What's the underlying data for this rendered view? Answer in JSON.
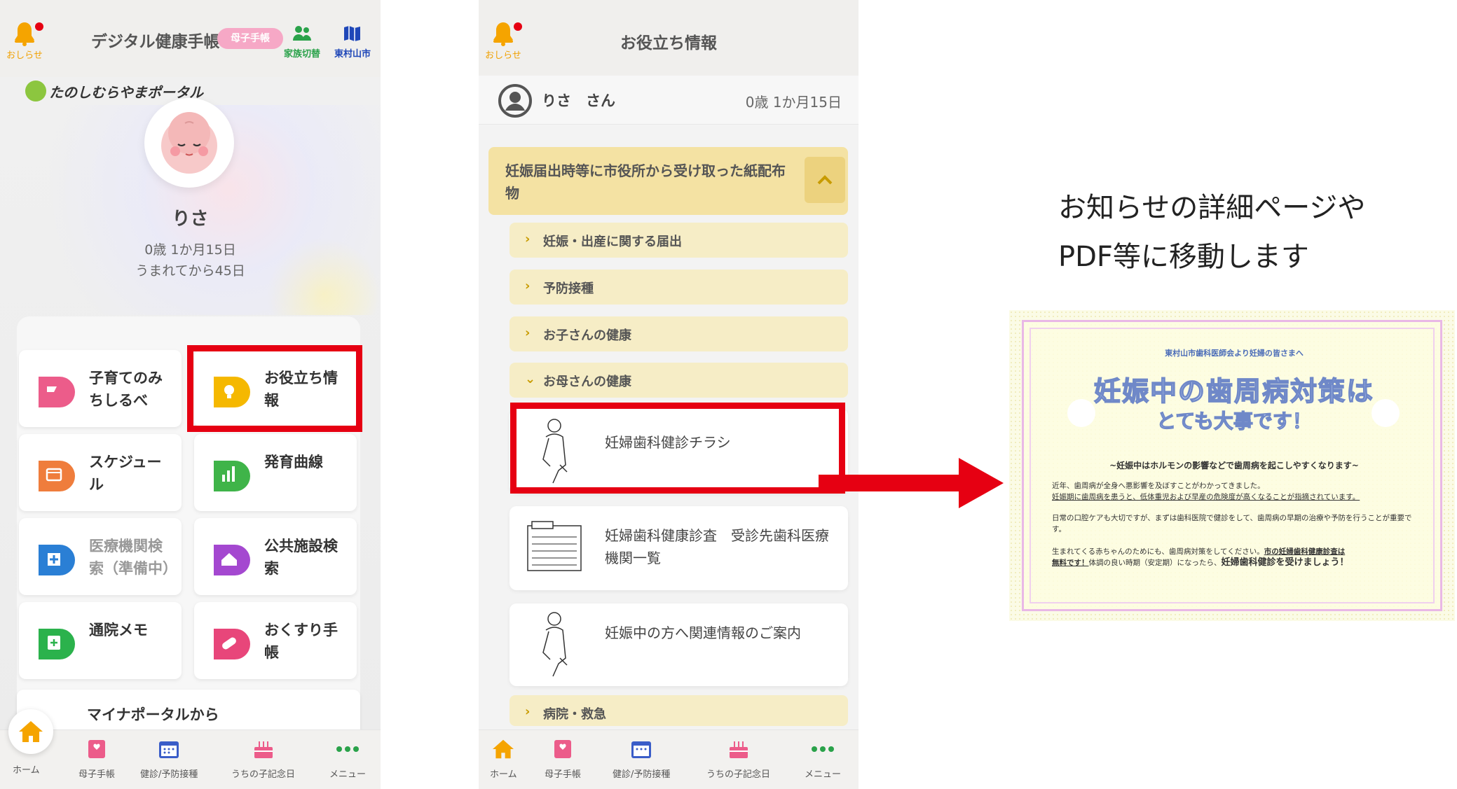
{
  "left_screen": {
    "notify_label": "おしらせ",
    "title": "デジタル健康手帳",
    "badge": "母子手帳",
    "family_switch_label": "家族切替",
    "city_label": "東村山市",
    "brand_logo_text": "たのしむらやまポータル",
    "child_name": "りさ",
    "child_age": "0歳 1か月15日",
    "child_days": "うまれてから45日",
    "menu": [
      {
        "label": "子育てのみちしるべ",
        "color": "#ec5c8a"
      },
      {
        "label": "お役立ち情報",
        "color": "#f5b800"
      },
      {
        "label": "スケジュール",
        "color": "#ef7d3c"
      },
      {
        "label": "発育曲線",
        "color": "#3fb449"
      },
      {
        "label": "医療機関検索（準備中）",
        "color": "#2a7fd5"
      },
      {
        "label": "公共施設検索",
        "color": "#a448d0"
      },
      {
        "label": "通院メモ",
        "color": "#2bb24c"
      },
      {
        "label": "おくすり手帳",
        "color": "#e8467a"
      }
    ],
    "partial_tile_label": "マイナポータルから",
    "tabs": [
      "ホーム",
      "母子手帳",
      "健診/予防接種",
      "うちの子記念日",
      "メニュー"
    ]
  },
  "middle_screen": {
    "notify_label": "おしらせ",
    "title": "お役立ち情報",
    "user_name": "りさ　さん",
    "user_age": "0歳 1か月15日",
    "accordion_title": "妊娠届出時等に市役所から受け取った紙配布物",
    "sub_items": [
      {
        "chev": "›",
        "label": "妊娠・出産に関する届出"
      },
      {
        "chev": "›",
        "label": "予防接種"
      },
      {
        "chev": "›",
        "label": "お子さんの健康"
      },
      {
        "chev": "⌄",
        "label": "お母さんの健康"
      }
    ],
    "documents": [
      "妊婦歯科健診チラシ",
      "妊婦歯科健康診査　受診先歯科医療機関一覧",
      "妊娠中の方へ関連情報のご案内"
    ],
    "bottom_item": "病院・救急",
    "tabs": [
      "ホーム",
      "母子手帳",
      "健診/予防接種",
      "うちの子記念日",
      "メニュー"
    ]
  },
  "caption": {
    "line1": "お知らせの詳細ページや",
    "line2": "PDF等に移動します"
  },
  "flyer": {
    "org": "東村山市歯科医師会より妊婦の皆さまへ",
    "title_line1": "妊娠中の歯周病対策は",
    "title_line2": "とても大事です！",
    "subtitle": "~妊娠中はホルモンの影響などで歯周病を起こしやすくなります~",
    "p1a": "近年、歯周病が全身へ悪影響を及ぼすことがわかってきました。",
    "p1b": "妊娠期に歯周病を患うと、低体重児および早産の危険度が高くなることが指摘されています。",
    "p2": "日常の口腔ケアも大切ですが、まずは歯科医院で健診をして、歯周病の早期の治療や予防を行うことが重要です。",
    "p3a": "生まれてくる赤ちゃんのためにも、歯周病対策をしてください。",
    "p3b": "市の妊婦歯科健康診査は",
    "p3c": "無料です！",
    "p3d": "体調の良い時期（安定期）になったら、",
    "p3e": "妊婦歯科健診を受けましょう！"
  },
  "colors": {
    "highlight": "#e60012",
    "accordion": "#f4e2a3",
    "sub_item": "#f6edc6"
  }
}
